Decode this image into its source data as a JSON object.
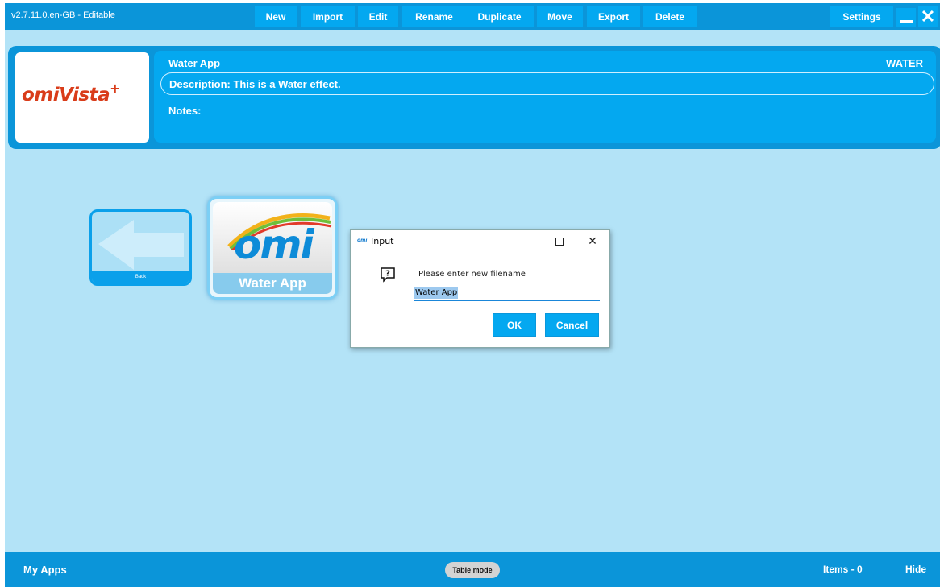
{
  "app": {
    "version_label": "v2.7.11.0.en-GB - Editable"
  },
  "toolbar": {
    "new_label": "New",
    "import_label": "Import",
    "edit_label": "Edit",
    "rename_label": "Rename",
    "duplicate_label": "Duplicate",
    "move_label": "Move",
    "export_label": "Export",
    "delete_label": "Delete",
    "settings_label": "Settings",
    "close_glyph": "✕"
  },
  "header": {
    "logo_text": "omiVista",
    "logo_plus": "+",
    "app_title": "Water App",
    "app_code": "WATER",
    "description": "Description: This is a Water effect.",
    "notes_label": "Notes:"
  },
  "tiles": {
    "back_label": "Back",
    "app_logo_text": "omi",
    "app_label": "Water App"
  },
  "dialog": {
    "app_icon_text": "omi",
    "title": "Input",
    "min_glyph": "—",
    "close_glyph": "✕",
    "prompt": "Please enter new filename",
    "input_value": "Water App",
    "ok_label": "OK",
    "cancel_label": "Cancel"
  },
  "footer": {
    "section_label": "My Apps",
    "table_mode_label": "Table mode",
    "items_count": "Items - 0",
    "hide_label": "Hide"
  },
  "colors": {
    "primary_blue": "#0b95d9",
    "accent_blue": "#04a8f0",
    "background": "#b3e3f7",
    "logo_red": "#d93c1a"
  }
}
